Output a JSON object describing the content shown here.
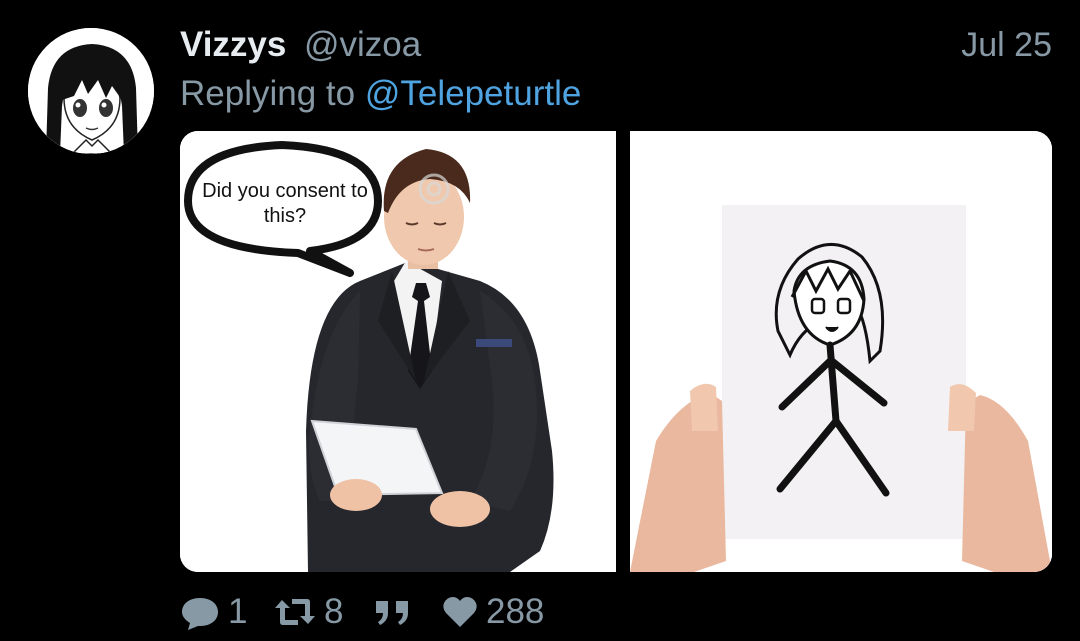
{
  "tweet": {
    "display_name": "Vizzys",
    "handle": "@vizoa",
    "date": "Jul 25",
    "replying_prefix": "Replying to",
    "replying_to": "@Telepeturtle"
  },
  "media": {
    "speech_bubble_text": "Did you consent to this?"
  },
  "actions": {
    "reply_count": "1",
    "retweet_count": "8",
    "like_count": "288"
  },
  "colors": {
    "background": "#000000",
    "primary_text": "#e6ecf0",
    "secondary_text": "#8899a6",
    "mention": "#4fa3e0"
  },
  "icons": [
    "avatar",
    "reply-icon",
    "retweet-icon",
    "quote-icon",
    "heart-icon"
  ]
}
